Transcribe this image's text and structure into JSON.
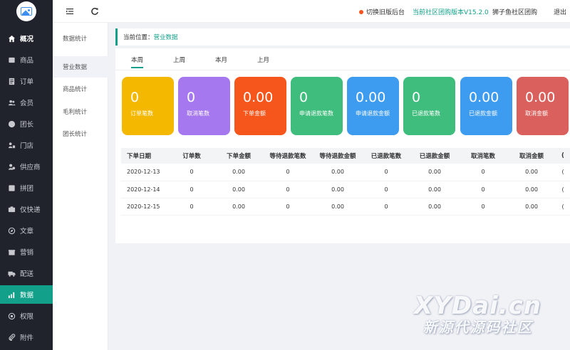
{
  "sidebar": {
    "items": [
      {
        "label": "概况",
        "icon": "home-icon"
      },
      {
        "label": "商品",
        "icon": "goods-icon"
      },
      {
        "label": "订单",
        "icon": "order-icon"
      },
      {
        "label": "会员",
        "icon": "members-icon"
      },
      {
        "label": "团长",
        "icon": "leader-icon"
      },
      {
        "label": "门店",
        "icon": "store-icon"
      },
      {
        "label": "供应商",
        "icon": "supplier-icon"
      },
      {
        "label": "拼团",
        "icon": "groupbuy-icon"
      },
      {
        "label": "仅快递",
        "icon": "express-icon"
      },
      {
        "label": "文章",
        "icon": "article-icon"
      },
      {
        "label": "营销",
        "icon": "marketing-icon"
      },
      {
        "label": "配送",
        "icon": "delivery-icon"
      },
      {
        "label": "数据",
        "icon": "data-icon"
      },
      {
        "label": "权限",
        "icon": "permission-icon"
      },
      {
        "label": "附件",
        "icon": "attachment-icon"
      }
    ],
    "active_index": 12,
    "active_color": "#12a08a"
  },
  "subnav": {
    "items": [
      "数据统计",
      "营业数据",
      "商品统计",
      "毛利统计",
      "团长统计"
    ],
    "active_index": 1
  },
  "header": {
    "switch_label": "切换旧版后台",
    "version_label": "当前社区团购版本V15.2.0",
    "shop_name": "狮子鱼社区团购",
    "logout_label": "退出"
  },
  "breadcrumb": {
    "prefix": "当前位置：",
    "current": "营业数据"
  },
  "tabs": [
    {
      "label": "本周",
      "active": true
    },
    {
      "label": "上周",
      "active": false
    },
    {
      "label": "本月",
      "active": false
    },
    {
      "label": "上月",
      "active": false
    }
  ],
  "cards": [
    {
      "value": "0",
      "label": "订单笔数",
      "color": "#f5b800"
    },
    {
      "value": "0",
      "label": "取消笔数",
      "color": "#a678ef"
    },
    {
      "value": "0.00",
      "label": "下单金额",
      "color": "#f6561c"
    },
    {
      "value": "0",
      "label": "申请退款笔数",
      "color": "#3fbd7c"
    },
    {
      "value": "0.00",
      "label": "申请退款金额",
      "color": "#3d9bf0"
    },
    {
      "value": "0",
      "label": "已退款笔数",
      "color": "#3fbd7c"
    },
    {
      "value": "0.00",
      "label": "已退款金额",
      "color": "#3d9bf0"
    },
    {
      "value": "0.00",
      "label": "取消金额",
      "color": "#d9605c"
    }
  ],
  "table": {
    "headers": [
      "下单日期",
      "订单数",
      "下单金额",
      "等待退款笔数",
      "等待退款金额",
      "已退款笔数",
      "已退款金额",
      "取消笔数",
      "取消金额",
      "("
    ],
    "rows": [
      [
        "2020-12-13",
        "0",
        "0.00",
        "0",
        "0.00",
        "0",
        "0.00",
        "0",
        "0.00",
        "("
      ],
      [
        "2020-12-14",
        "0",
        "0.00",
        "0",
        "0.00",
        "0",
        "0.00",
        "0",
        "0.00",
        "("
      ],
      [
        "2020-12-15",
        "0",
        "0.00",
        "0",
        "0.00",
        "0",
        "0.00",
        "0",
        "0.00",
        "("
      ]
    ]
  },
  "watermark": {
    "line1": "XYDai.cn",
    "line2": "新源代源码社区"
  }
}
